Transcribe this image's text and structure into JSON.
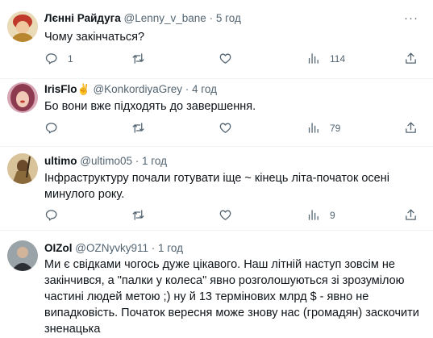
{
  "tweets": [
    {
      "name": "Лєнні Райдуга",
      "handle": "@Lenny_v_bane",
      "separator": "·",
      "time": "5 год",
      "badge": "",
      "text": "Чому закінчаться?",
      "reply_count": "1",
      "retweet_count": "",
      "like_count": "",
      "views_count": "114"
    },
    {
      "name": "IrisFlo",
      "handle": "@KonkordiyaGrey",
      "separator": "·",
      "time": "4 год",
      "badge": "✌",
      "text": "Бо вони вже підходять до завершення.",
      "reply_count": "",
      "retweet_count": "",
      "like_count": "",
      "views_count": "79"
    },
    {
      "name": "ultimo",
      "handle": "@ultimo05",
      "separator": "·",
      "time": "1 год",
      "badge": "",
      "text": "Інфраструктуру почали готувати іще ~ кінець літа-початок осені минулого року.",
      "reply_count": "",
      "retweet_count": "",
      "like_count": "",
      "views_count": "9"
    },
    {
      "name": "OIZol",
      "handle": "@OZNyvky911",
      "separator": "·",
      "time": "1 год",
      "badge": "",
      "text": "Ми є свідками чогось дуже цікавого. Наш літній наступ зовсім не закінчився, а \"палки у колеса\" явно розголошуються зі зрозумілою частині людей метою ;) ну й  13 термінових млрд $ - явно не випадковість. Початок вересня може знову нас (громадян) заскочити зненацька",
      "reply_count": "",
      "retweet_count": "",
      "like_count": "",
      "views_count": ""
    }
  ],
  "more_label": "···",
  "icons": {
    "reply": "reply-icon",
    "retweet": "retweet-icon",
    "like": "heart-icon",
    "views": "views-icon",
    "share": "share-icon"
  },
  "colors": {
    "text": "#0f1419",
    "secondary": "#536471",
    "border": "#eff3f4"
  }
}
